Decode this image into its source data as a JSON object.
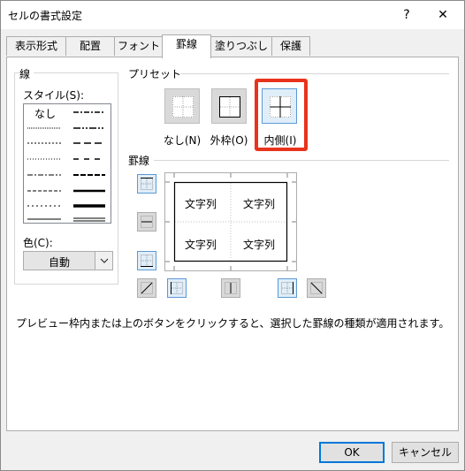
{
  "window": {
    "title": "セルの書式設定",
    "help_label": "?",
    "close_label": "✕"
  },
  "tabs": [
    {
      "label": "表示形式"
    },
    {
      "label": "配置"
    },
    {
      "label": "フォント"
    },
    {
      "label": "罫線",
      "active": true
    },
    {
      "label": "塗りつぶし"
    },
    {
      "label": "保護"
    }
  ],
  "line_group": {
    "title": "線",
    "style_label": "スタイル(S):",
    "none_label": "なし",
    "color_label": "色(C):",
    "color_value": "自動"
  },
  "preset_group": {
    "title": "プリセット",
    "buttons": [
      {
        "label": "なし(N)"
      },
      {
        "label": "外枠(O)"
      },
      {
        "label": "内側(I)"
      }
    ]
  },
  "border_group": {
    "title": "罫線",
    "preview_cells": [
      "文字列",
      "文字列",
      "文字列",
      "文字列"
    ]
  },
  "hint": "プレビュー枠内または上のボタンをクリックすると、選択した罫線の種類が適用されます。",
  "footer": {
    "ok_label": "OK",
    "cancel_label": "キャンセル"
  },
  "colors": {
    "highlight": "#e8331c",
    "accent": "#0078d7"
  }
}
